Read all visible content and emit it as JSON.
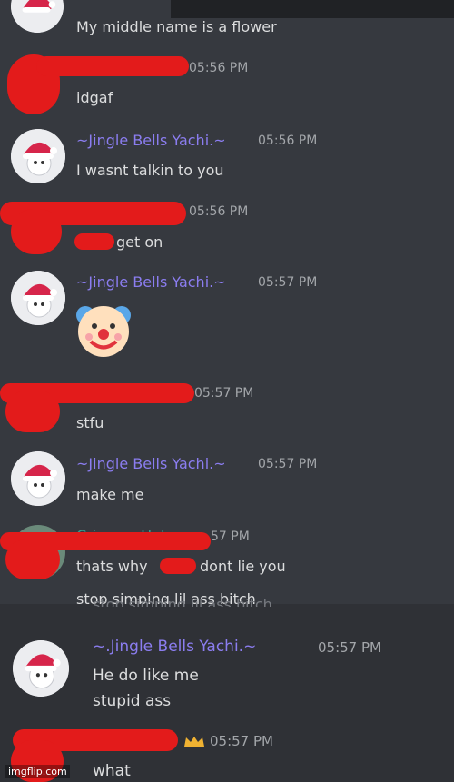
{
  "messages": [
    {
      "user": "",
      "time": "",
      "text": "My middle name is a flower"
    },
    {
      "user": "",
      "time": "05:56 PM",
      "text": "idgaf"
    },
    {
      "user": "~Jingle Bells Yachi.~",
      "time": "05:56 PM",
      "text": "I wasnt talkin to you"
    },
    {
      "user": "",
      "time": "05:56 PM",
      "text": "get on"
    },
    {
      "user": "~Jingle Bells Yachi.~",
      "time": "05:57 PM",
      "text": ""
    },
    {
      "user": "",
      "time": "05:57 PM",
      "text": "stfu"
    },
    {
      "user": "~Jingle Bells Yachi.~",
      "time": "05:57 PM",
      "text": "make me"
    },
    {
      "user": "",
      "time": "57 PM",
      "text": "thats why",
      "text_after": "dont lie you"
    },
    {
      "user": "",
      "time": "",
      "text": "stop simping lil ass bitch"
    },
    {
      "user": "~.Jingle Bells Yachi.~",
      "time": "05:57 PM",
      "text": "He do like me"
    },
    {
      "user": "",
      "time": "",
      "text": "stupid ass"
    },
    {
      "user": "",
      "time": "05:57 PM",
      "text": "what"
    }
  ],
  "partial_name": "Crimson Hat",
  "watermark": "imgflip.com",
  "colors": {
    "background": "#36393f",
    "username": "#8b7df0",
    "text": "#dcddde",
    "timestamp": "#a3a6aa",
    "redaction": "#e31b1b"
  },
  "icons": [
    "avatar-santa-hat-icon",
    "clown-face-emoji-icon",
    "crown-icon"
  ]
}
